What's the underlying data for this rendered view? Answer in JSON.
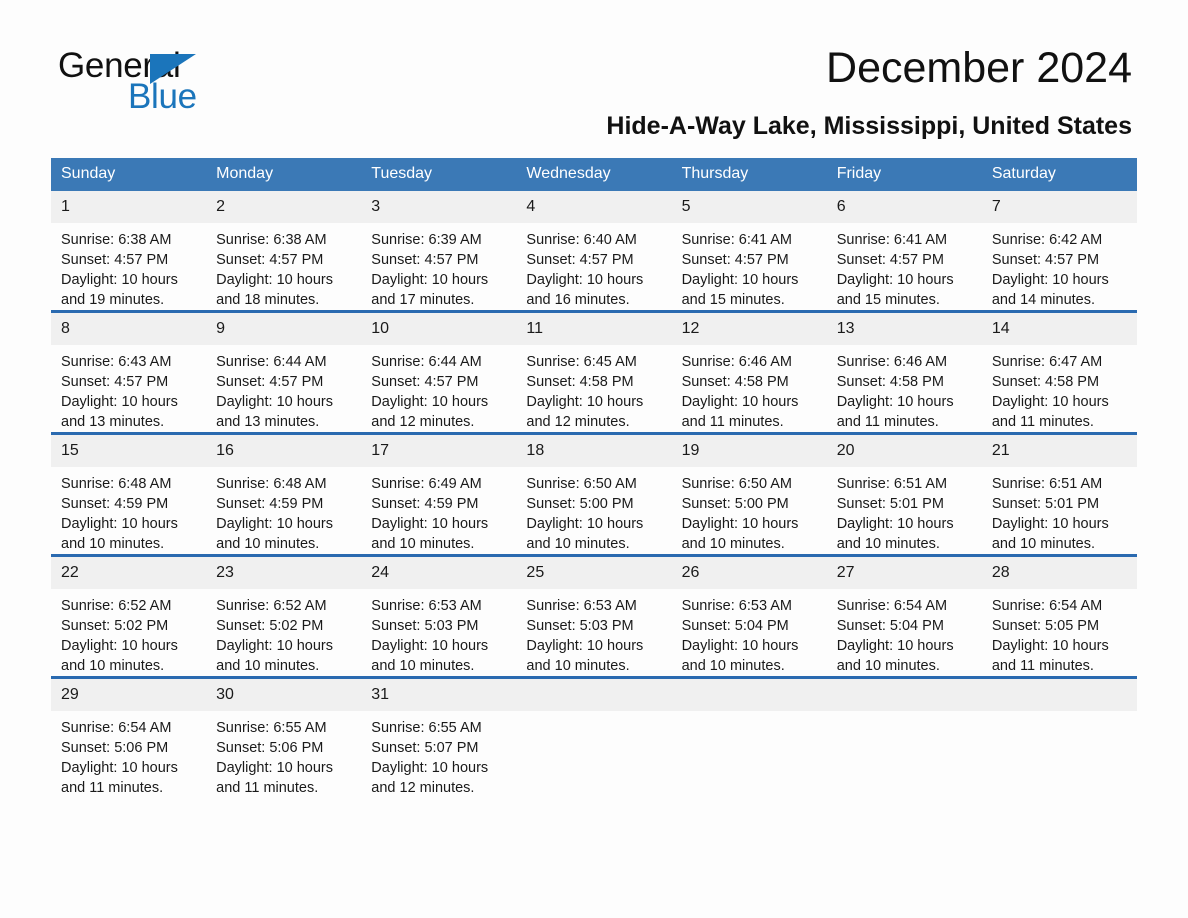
{
  "brand": {
    "name_part1": "General",
    "name_part2": "Blue",
    "accent_color": "#1b75bb"
  },
  "header": {
    "title": "December 2024",
    "location": "Hide-A-Way Lake, Mississippi, United States"
  },
  "colors": {
    "header_bar": "#3b79b6",
    "row_divider": "#2a6ab0",
    "day_band": "#f0f0f0",
    "page_background": "#fdfdfd"
  },
  "calendar": {
    "weekday_headers": [
      "Sunday",
      "Monday",
      "Tuesday",
      "Wednesday",
      "Thursday",
      "Friday",
      "Saturday"
    ],
    "weeks": [
      [
        {
          "day": "1",
          "sunrise": "Sunrise: 6:38 AM",
          "sunset": "Sunset: 4:57 PM",
          "daylight": "Daylight: 10 hours and 19 minutes."
        },
        {
          "day": "2",
          "sunrise": "Sunrise: 6:38 AM",
          "sunset": "Sunset: 4:57 PM",
          "daylight": "Daylight: 10 hours and 18 minutes."
        },
        {
          "day": "3",
          "sunrise": "Sunrise: 6:39 AM",
          "sunset": "Sunset: 4:57 PM",
          "daylight": "Daylight: 10 hours and 17 minutes."
        },
        {
          "day": "4",
          "sunrise": "Sunrise: 6:40 AM",
          "sunset": "Sunset: 4:57 PM",
          "daylight": "Daylight: 10 hours and 16 minutes."
        },
        {
          "day": "5",
          "sunrise": "Sunrise: 6:41 AM",
          "sunset": "Sunset: 4:57 PM",
          "daylight": "Daylight: 10 hours and 15 minutes."
        },
        {
          "day": "6",
          "sunrise": "Sunrise: 6:41 AM",
          "sunset": "Sunset: 4:57 PM",
          "daylight": "Daylight: 10 hours and 15 minutes."
        },
        {
          "day": "7",
          "sunrise": "Sunrise: 6:42 AM",
          "sunset": "Sunset: 4:57 PM",
          "daylight": "Daylight: 10 hours and 14 minutes."
        }
      ],
      [
        {
          "day": "8",
          "sunrise": "Sunrise: 6:43 AM",
          "sunset": "Sunset: 4:57 PM",
          "daylight": "Daylight: 10 hours and 13 minutes."
        },
        {
          "day": "9",
          "sunrise": "Sunrise: 6:44 AM",
          "sunset": "Sunset: 4:57 PM",
          "daylight": "Daylight: 10 hours and 13 minutes."
        },
        {
          "day": "10",
          "sunrise": "Sunrise: 6:44 AM",
          "sunset": "Sunset: 4:57 PM",
          "daylight": "Daylight: 10 hours and 12 minutes."
        },
        {
          "day": "11",
          "sunrise": "Sunrise: 6:45 AM",
          "sunset": "Sunset: 4:58 PM",
          "daylight": "Daylight: 10 hours and 12 minutes."
        },
        {
          "day": "12",
          "sunrise": "Sunrise: 6:46 AM",
          "sunset": "Sunset: 4:58 PM",
          "daylight": "Daylight: 10 hours and 11 minutes."
        },
        {
          "day": "13",
          "sunrise": "Sunrise: 6:46 AM",
          "sunset": "Sunset: 4:58 PM",
          "daylight": "Daylight: 10 hours and 11 minutes."
        },
        {
          "day": "14",
          "sunrise": "Sunrise: 6:47 AM",
          "sunset": "Sunset: 4:58 PM",
          "daylight": "Daylight: 10 hours and 11 minutes."
        }
      ],
      [
        {
          "day": "15",
          "sunrise": "Sunrise: 6:48 AM",
          "sunset": "Sunset: 4:59 PM",
          "daylight": "Daylight: 10 hours and 10 minutes."
        },
        {
          "day": "16",
          "sunrise": "Sunrise: 6:48 AM",
          "sunset": "Sunset: 4:59 PM",
          "daylight": "Daylight: 10 hours and 10 minutes."
        },
        {
          "day": "17",
          "sunrise": "Sunrise: 6:49 AM",
          "sunset": "Sunset: 4:59 PM",
          "daylight": "Daylight: 10 hours and 10 minutes."
        },
        {
          "day": "18",
          "sunrise": "Sunrise: 6:50 AM",
          "sunset": "Sunset: 5:00 PM",
          "daylight": "Daylight: 10 hours and 10 minutes."
        },
        {
          "day": "19",
          "sunrise": "Sunrise: 6:50 AM",
          "sunset": "Sunset: 5:00 PM",
          "daylight": "Daylight: 10 hours and 10 minutes."
        },
        {
          "day": "20",
          "sunrise": "Sunrise: 6:51 AM",
          "sunset": "Sunset: 5:01 PM",
          "daylight": "Daylight: 10 hours and 10 minutes."
        },
        {
          "day": "21",
          "sunrise": "Sunrise: 6:51 AM",
          "sunset": "Sunset: 5:01 PM",
          "daylight": "Daylight: 10 hours and 10 minutes."
        }
      ],
      [
        {
          "day": "22",
          "sunrise": "Sunrise: 6:52 AM",
          "sunset": "Sunset: 5:02 PM",
          "daylight": "Daylight: 10 hours and 10 minutes."
        },
        {
          "day": "23",
          "sunrise": "Sunrise: 6:52 AM",
          "sunset": "Sunset: 5:02 PM",
          "daylight": "Daylight: 10 hours and 10 minutes."
        },
        {
          "day": "24",
          "sunrise": "Sunrise: 6:53 AM",
          "sunset": "Sunset: 5:03 PM",
          "daylight": "Daylight: 10 hours and 10 minutes."
        },
        {
          "day": "25",
          "sunrise": "Sunrise: 6:53 AM",
          "sunset": "Sunset: 5:03 PM",
          "daylight": "Daylight: 10 hours and 10 minutes."
        },
        {
          "day": "26",
          "sunrise": "Sunrise: 6:53 AM",
          "sunset": "Sunset: 5:04 PM",
          "daylight": "Daylight: 10 hours and 10 minutes."
        },
        {
          "day": "27",
          "sunrise": "Sunrise: 6:54 AM",
          "sunset": "Sunset: 5:04 PM",
          "daylight": "Daylight: 10 hours and 10 minutes."
        },
        {
          "day": "28",
          "sunrise": "Sunrise: 6:54 AM",
          "sunset": "Sunset: 5:05 PM",
          "daylight": "Daylight: 10 hours and 11 minutes."
        }
      ],
      [
        {
          "day": "29",
          "sunrise": "Sunrise: 6:54 AM",
          "sunset": "Sunset: 5:06 PM",
          "daylight": "Daylight: 10 hours and 11 minutes."
        },
        {
          "day": "30",
          "sunrise": "Sunrise: 6:55 AM",
          "sunset": "Sunset: 5:06 PM",
          "daylight": "Daylight: 10 hours and 11 minutes."
        },
        {
          "day": "31",
          "sunrise": "Sunrise: 6:55 AM",
          "sunset": "Sunset: 5:07 PM",
          "daylight": "Daylight: 10 hours and 12 minutes."
        },
        {
          "day": "",
          "sunrise": "",
          "sunset": "",
          "daylight": ""
        },
        {
          "day": "",
          "sunrise": "",
          "sunset": "",
          "daylight": ""
        },
        {
          "day": "",
          "sunrise": "",
          "sunset": "",
          "daylight": ""
        },
        {
          "day": "",
          "sunrise": "",
          "sunset": "",
          "daylight": ""
        }
      ]
    ]
  }
}
